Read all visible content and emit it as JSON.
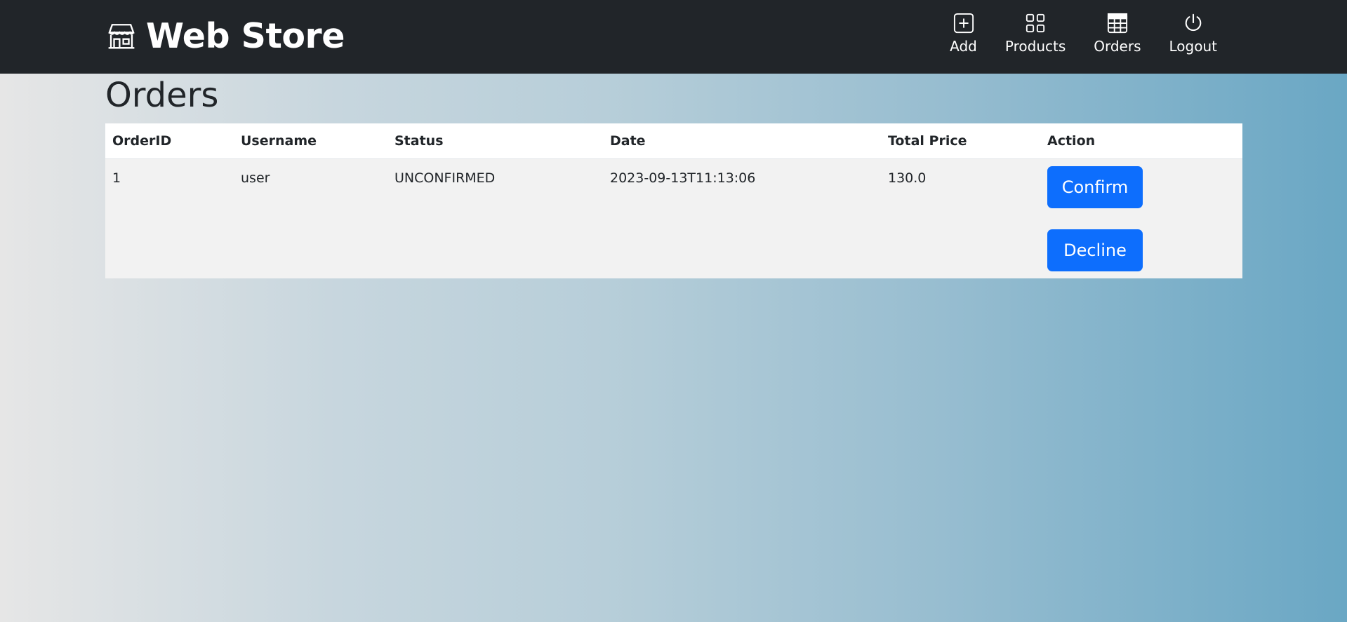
{
  "navbar": {
    "brand": "Web Store",
    "items": [
      {
        "label": "Add",
        "icon": "plus-square-icon"
      },
      {
        "label": "Products",
        "icon": "grid-icon"
      },
      {
        "label": "Orders",
        "icon": "table-icon"
      },
      {
        "label": "Logout",
        "icon": "power-icon"
      }
    ]
  },
  "page": {
    "title": "Orders"
  },
  "table": {
    "headers": [
      "OrderID",
      "Username",
      "Status",
      "Date",
      "Total Price",
      "Action"
    ],
    "rows": [
      {
        "order_id": "1",
        "username": "user",
        "status": "UNCONFIRMED",
        "date": "2023-09-13T11:13:06",
        "total_price": "130.0",
        "confirm_label": "Confirm",
        "decline_label": "Decline"
      }
    ]
  },
  "colors": {
    "navbar": "#212529",
    "button": "#0d6efd"
  }
}
